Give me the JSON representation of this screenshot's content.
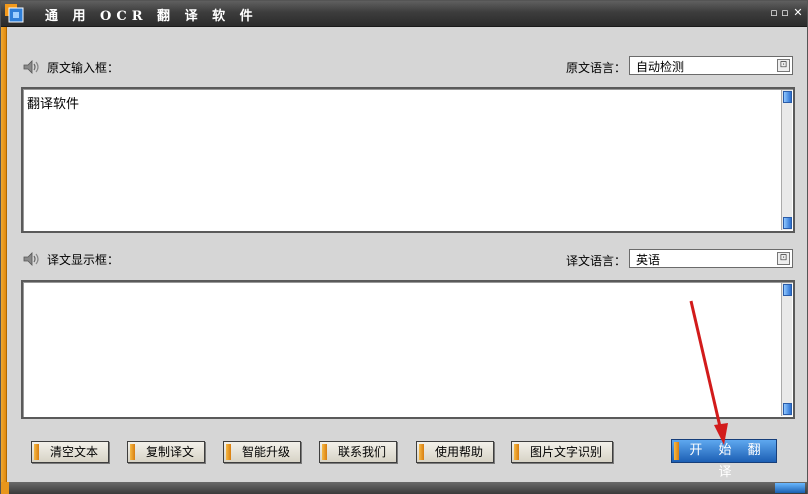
{
  "window": {
    "title": "通 用 OCR 翻 译 软 件",
    "controls": {
      "minimize": "▫",
      "maximize": "▫",
      "close": "✕"
    }
  },
  "source": {
    "label": "原文输入框：",
    "lang_label": "原文语言：",
    "lang_value": "自动检测",
    "text": "翻译软件"
  },
  "target": {
    "label": "译文显示框：",
    "lang_label": "译文语言：",
    "lang_value": "英语",
    "text": ""
  },
  "buttons": {
    "clear": "清空文本",
    "copy": "复制译文",
    "upgrade": "智能升级",
    "contact": "联系我们",
    "help": "使用帮助",
    "ocr": "图片文字识别",
    "translate": "开 始 翻 译"
  },
  "colors": {
    "accent_orange": "#e8961c",
    "accent_blue": "#1c5fb4",
    "annotation_arrow": "#d21b1b"
  },
  "icons": {
    "speaker": "speaker-icon",
    "dropdown": "dropdown-icon",
    "logo": "app-logo-icon"
  }
}
